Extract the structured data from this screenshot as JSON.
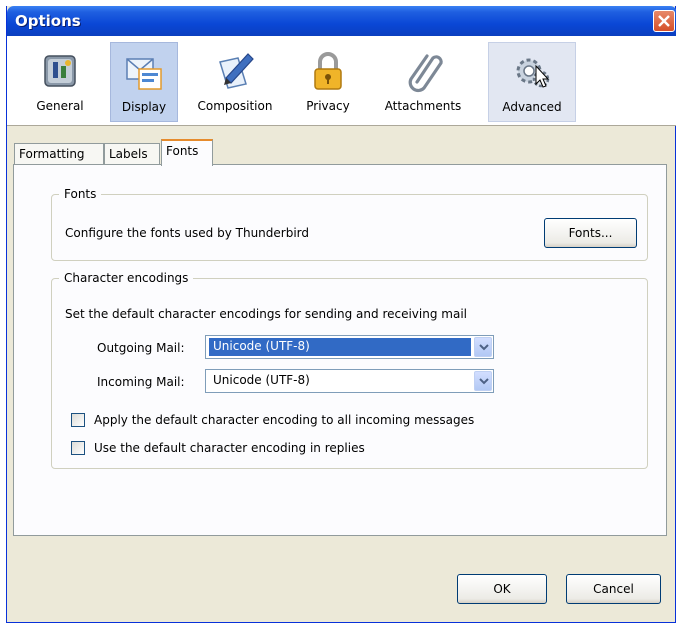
{
  "window": {
    "title": "Options"
  },
  "toolbar": {
    "items": [
      {
        "label": "General",
        "icon": "general-icon"
      },
      {
        "label": "Display",
        "icon": "display-icon",
        "selected": true
      },
      {
        "label": "Composition",
        "icon": "composition-icon"
      },
      {
        "label": "Privacy",
        "icon": "padlock-icon"
      },
      {
        "label": "Attachments",
        "icon": "paperclip-icon"
      },
      {
        "label": "Advanced",
        "icon": "gears-icon",
        "hover": true
      }
    ]
  },
  "tabs": [
    {
      "label": "Formatting"
    },
    {
      "label": "Labels"
    },
    {
      "label": "Fonts",
      "active": true
    }
  ],
  "fonts_group": {
    "legend": "Fonts",
    "description": "Configure the fonts used by Thunderbird",
    "button_label": "Fonts..."
  },
  "encoding_group": {
    "legend": "Character encodings",
    "description": "Set the default character encodings for sending and receiving mail",
    "outgoing_label": "Outgoing Mail:",
    "outgoing_value": "Unicode (UTF-8)",
    "incoming_label": "Incoming Mail:",
    "incoming_value": "Unicode (UTF-8)",
    "checkbox_apply_label": "Apply the default character encoding to all incoming messages",
    "checkbox_apply_checked": false,
    "checkbox_replies_label": "Use the default character encoding in replies",
    "checkbox_replies_checked": false
  },
  "footer": {
    "ok_label": "OK",
    "cancel_label": "Cancel"
  },
  "colors": {
    "titlebar": "#0a47d6",
    "selected_tab_accent": "#e68b2c",
    "selection": "#316ac5",
    "dialog_bg": "#ece9d8"
  }
}
